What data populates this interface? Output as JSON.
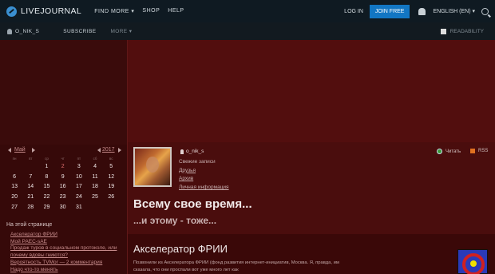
{
  "topbar": {
    "logo_text": "LIVEJOURNAL",
    "nav": [
      "FIND MORE ▾",
      "SHOP",
      "HELP"
    ],
    "login": "LOG IN",
    "join": "JOIN FREE",
    "language": "ENGLISH (EN) ▾"
  },
  "subbar": {
    "username": "O_NIK_S",
    "subscribe": "SUBSCRIBE",
    "more": "MORE ▾",
    "readability": "READABILITY"
  },
  "calendar": {
    "month": "Май",
    "year": "2017",
    "weekdays": [
      "пн",
      "вт",
      "ср",
      "чт",
      "пт",
      "сб",
      "вс"
    ],
    "rows": [
      [
        "",
        "",
        "1",
        "2",
        "3",
        "4",
        "5"
      ],
      [
        "6",
        "7",
        "8",
        "9",
        "10",
        "11",
        "12"
      ],
      [
        "13",
        "14",
        "15",
        "16",
        "17",
        "18",
        "19"
      ],
      [
        "20",
        "21",
        "22",
        "23",
        "24",
        "25",
        "26"
      ],
      [
        "27",
        "28",
        "29",
        "30",
        "31",
        "",
        ""
      ]
    ]
  },
  "on_this_page": {
    "title": "На этой странице",
    "items": [
      "Акселератор ФРИИ",
      "Мой РАЕС-sAE",
      "Продаж туров в социальном протоколе, или",
      "почему вдовы гниются?",
      "Вероятность TVMor — 2 комментария",
      "Надо что-то менять"
    ]
  },
  "profile": {
    "username": "o_nik_s",
    "links": [
      "Свежие записи",
      "Друзья",
      "Архив",
      "Личная информация"
    ],
    "follow": "Читать",
    "rss": "RSS"
  },
  "journal": {
    "title": "Всему свое время...",
    "subtitle": "...и этому - тоже..."
  },
  "post": {
    "title": "Акселератор ФРИИ",
    "text": "Позвонили из Акселератора ФРИИ (фонд развития интернет-инициатив, Москва. Я, правда, им сказала, что они проспали вот уже много лет как"
  }
}
